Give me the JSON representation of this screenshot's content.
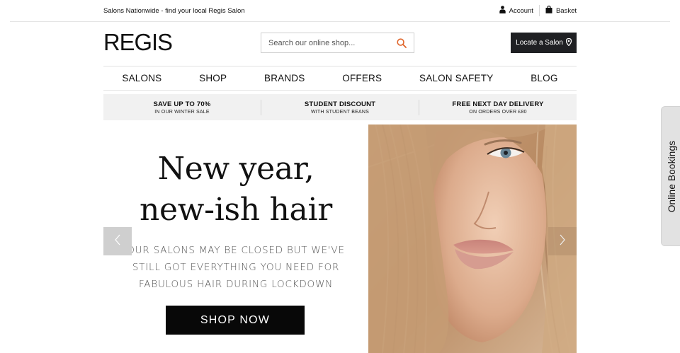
{
  "topbar": {
    "tagline": "Salons Nationwide - find your local Regis Salon",
    "account_label": "Account",
    "basket_label": "Basket",
    "account_icon": "person-icon",
    "basket_icon": "shopping-bag-icon"
  },
  "header": {
    "logo_text": "REGIS",
    "search_placeholder": "Search our online shop...",
    "search_icon": "magnifier-icon",
    "locate_label": "Locate a Salon",
    "locate_icon": "map-pin-icon"
  },
  "nav": {
    "items": [
      {
        "label": "SALONS"
      },
      {
        "label": "SHOP"
      },
      {
        "label": "BRANDS"
      },
      {
        "label": "OFFERS"
      },
      {
        "label": "SALON SAFETY"
      },
      {
        "label": "BLOG"
      }
    ]
  },
  "promos": [
    {
      "title": "SAVE UP TO 70%",
      "subtitle": "IN OUR WINTER SALE"
    },
    {
      "title": "STUDENT DISCOUNT",
      "subtitle": "WITH STUDENT BEANS"
    },
    {
      "title": "FREE NEXT DAY DELIVERY",
      "subtitle": "ON ORDERS OVER £80"
    }
  ],
  "hero": {
    "headline_line1": "New year,",
    "headline_line2": "new-ish hair",
    "subtext_line1": "OUR SALONS MAY BE CLOSED BUT WE'VE",
    "subtext_line2": "STILL GOT EVERYTHING YOU NEED FOR",
    "subtext_line3": "FABULOUS HAIR DURING LOCKDOWN",
    "cta_label": "SHOP NOW",
    "prev_icon": "chevron-left-icon",
    "next_icon": "chevron-right-icon"
  },
  "side_tab": {
    "label": "Online Bookings"
  },
  "colors": {
    "dark_button": "#1f2023",
    "accent_search": "#e0652b",
    "promo_bg": "#f1f1f1",
    "side_tab_bg": "#e2e2e2"
  }
}
